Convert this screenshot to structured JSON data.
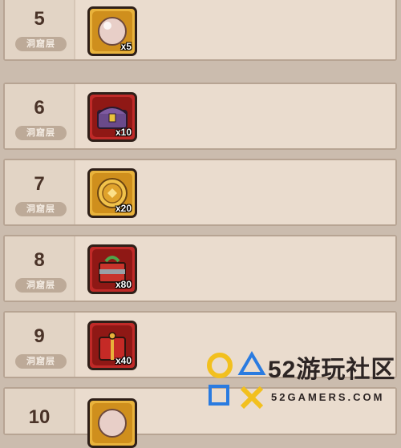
{
  "rows": [
    {
      "level": "5",
      "label": "洞窟层",
      "qty": "x5",
      "item_icon": "pearl-icon"
    },
    {
      "level": "6",
      "label": "洞窟层",
      "qty": "x10",
      "item_icon": "treasure-chest-icon"
    },
    {
      "level": "7",
      "label": "洞窟层",
      "qty": "x20",
      "item_icon": "gold-coin-icon"
    },
    {
      "level": "8",
      "label": "洞窟层",
      "qty": "x80",
      "item_icon": "red-gift-box-icon"
    },
    {
      "level": "9",
      "label": "洞窟层",
      "qty": "x40",
      "item_icon": "red-lucky-bag-icon"
    },
    {
      "level": "10",
      "label": "",
      "qty": "",
      "item_icon": "pearl-icon"
    }
  ],
  "watermark": {
    "title": "52游玩社区",
    "url": "52GAMERS.COM"
  },
  "colors": {
    "accent_gold": "#e9b33c",
    "accent_red": "#c02a28",
    "text_dark": "#4a3328"
  }
}
